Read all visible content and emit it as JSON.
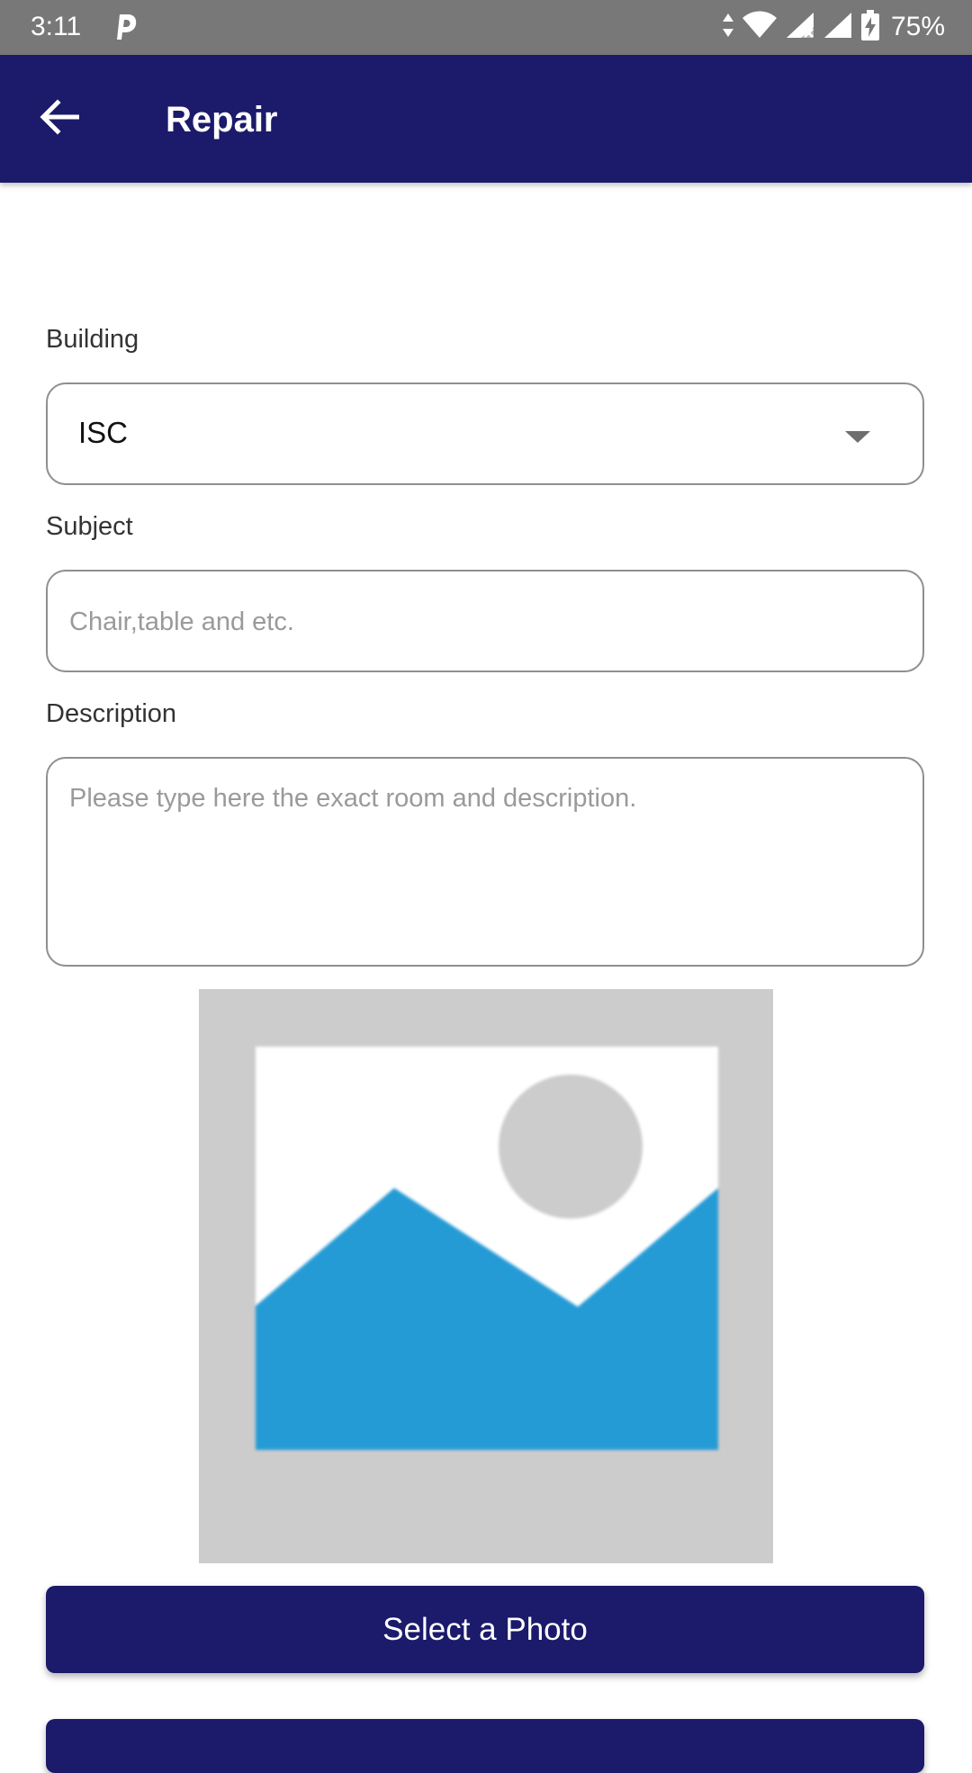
{
  "status_bar": {
    "time": "3:11",
    "battery": "75%",
    "icons": [
      "parking-notification-icon",
      "data-arrows-icon",
      "wifi-icon",
      "signal-no-sim-icon",
      "signal-icon",
      "battery-charging-icon"
    ]
  },
  "app_bar": {
    "title": "Repair",
    "back_icon": "arrow-left-icon",
    "background": "#1b1a6b"
  },
  "form": {
    "building": {
      "label": "Building",
      "selected": "ISC"
    },
    "subject": {
      "label": "Subject",
      "value": "",
      "placeholder": "Chair,table and etc."
    },
    "description": {
      "label": "Description",
      "value": "",
      "placeholder": "Please type here the exact room and description."
    }
  },
  "photo": {
    "icon": "image-placeholder-icon"
  },
  "buttons": {
    "select_photo": "Select a Photo",
    "second": ""
  },
  "colors": {
    "primary": "#1b1a6b",
    "status_bar": "#787878",
    "placeholder_sky": "#ffffff",
    "placeholder_mountain": "#259bd6",
    "placeholder_frame": "#cccccc"
  }
}
